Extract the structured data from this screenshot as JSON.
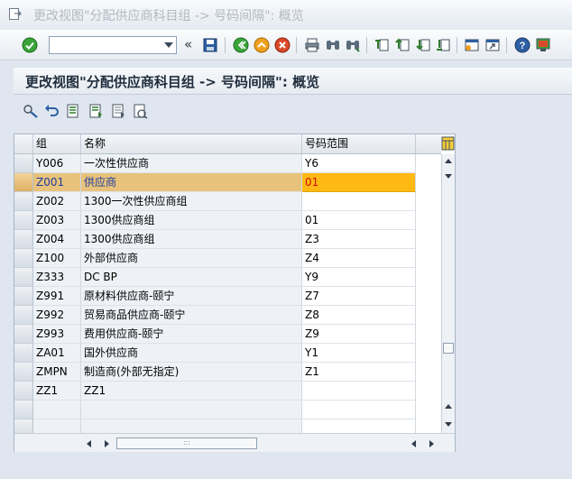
{
  "window": {
    "title": "更改视图\"分配供应商科目组 -> 号码间隔\": 概览"
  },
  "toolbar": {
    "command_value": "",
    "icons": [
      "ok-check-icon",
      "dropdown-icon",
      "collapse-icon",
      "save-icon",
      "back-icon",
      "exit-icon",
      "cancel-icon",
      "print-icon",
      "find-icon",
      "find-next-icon",
      "first-page-icon",
      "previous-page-icon",
      "next-page-icon",
      "last-page-icon",
      "new-session-icon",
      "shortcut-icon",
      "help-icon",
      "layout-icon"
    ],
    "collapse_glyph": "«"
  },
  "page": {
    "title": "更改视图\"分配供应商科目组 -> 号码间隔\": 概览"
  },
  "app_toolbar": {
    "icons": [
      "display-change-icon",
      "undo-icon",
      "select-all-icon",
      "select-block-icon",
      "deselect-all-icon",
      "variant-icon"
    ]
  },
  "table": {
    "columns": [
      "组",
      "名称",
      "号码范围"
    ],
    "rows": [
      {
        "group": "Y006",
        "name": "一次性供应商",
        "range": "Y6"
      },
      {
        "group": "Z001",
        "name": "供应商",
        "range": "01"
      },
      {
        "group": "Z002",
        "name": "1300一次性供应商组",
        "range": ""
      },
      {
        "group": "Z003",
        "name": "1300供应商组",
        "range": "01"
      },
      {
        "group": "Z004",
        "name": "1300供应商组",
        "range": "Z3"
      },
      {
        "group": "Z100",
        "name": "外部供应商",
        "range": "Z4"
      },
      {
        "group": "Z333",
        "name": "DC BP",
        "range": "Y9"
      },
      {
        "group": "Z991",
        "name": "原材料供应商-颐宁",
        "range": "Z7"
      },
      {
        "group": "Z992",
        "name": "贸易商品供应商-颐宁",
        "range": "Z8"
      },
      {
        "group": "Z993",
        "name": "费用供应商-颐宁",
        "range": "Z9"
      },
      {
        "group": "ZA01",
        "name": "国外供应商",
        "range": "Y1"
      },
      {
        "group": "ZMPN",
        "name": "制造商(外部无指定)",
        "range": "Z1"
      },
      {
        "group": "ZZ1",
        "name": "ZZ1",
        "range": ""
      },
      {
        "group": "",
        "name": "",
        "range": ""
      },
      {
        "group": "",
        "name": "",
        "range": ""
      }
    ],
    "selected_row_index": 1,
    "scroll_thumb_glyph": ":::"
  },
  "colors": {
    "selected_row": "#e8c27b",
    "selected_cell": "#ffb914",
    "selected_text": "#cc1100"
  }
}
